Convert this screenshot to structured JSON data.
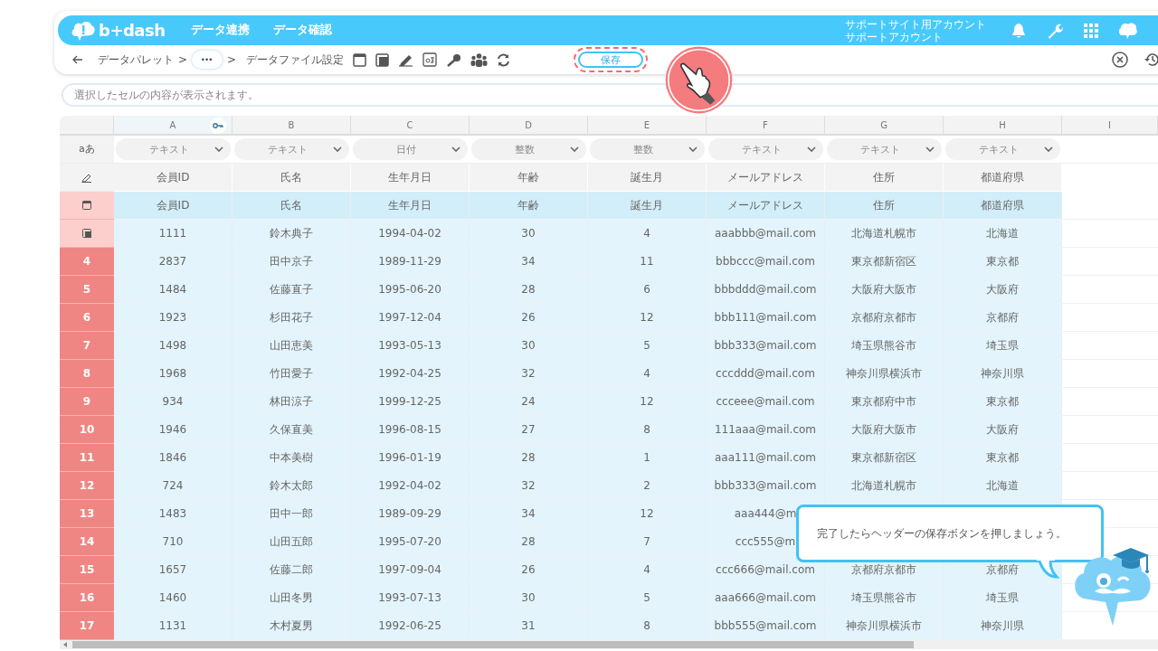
{
  "header": {
    "logo_text": "b+dash",
    "nav": [
      "データ連携",
      "データ確認"
    ],
    "account": [
      "サポートサイト用アカウント",
      "サポートアカウント"
    ]
  },
  "breadcrumb": [
    {
      "kind": "link",
      "text": "データパレット"
    },
    {
      "kind": "separator",
      "text": ">"
    },
    {
      "kind": "more",
      "text": "•••"
    },
    {
      "kind": "separator",
      "text": ">"
    },
    {
      "kind": "current",
      "text": "データファイル設定"
    }
  ],
  "save_button": {
    "label": "保存",
    "highlighted": true
  },
  "formula_bar": {
    "placeholder": "選択したセルの内容が表示されます。"
  },
  "type_row_label": "aあ",
  "columns": [
    {
      "letter": "A",
      "type": "テキスト",
      "key": true
    },
    {
      "letter": "B",
      "type": "テキスト",
      "key": false
    },
    {
      "letter": "C",
      "type": "日付",
      "key": false
    },
    {
      "letter": "D",
      "type": "整数",
      "key": false
    },
    {
      "letter": "E",
      "type": "整数",
      "key": false
    },
    {
      "letter": "F",
      "type": "テキスト",
      "key": false
    },
    {
      "letter": "G",
      "type": "テキスト",
      "key": false
    },
    {
      "letter": "H",
      "type": "テキスト",
      "key": false
    },
    {
      "letter": "I",
      "key": false
    }
  ],
  "rows": [
    {
      "kind": "label",
      "cells": [
        "会員ID",
        "氏名",
        "生年月日",
        "年齢",
        "誕生月",
        "メールアドレス",
        "住所",
        "都道府県"
      ]
    },
    {
      "kind": "header",
      "cells": [
        "会員ID",
        "氏名",
        "生年月日",
        "年齢",
        "誕生月",
        "メールアドレス",
        "住所",
        "都道府県"
      ]
    },
    {
      "kind": "first",
      "cells": [
        "1111",
        "鈴木典子",
        "1994-04-02",
        "30",
        "4",
        "aaabbb@mail.com",
        "北海道札幌市",
        "北海道"
      ]
    },
    {
      "kind": "data",
      "number": "4",
      "cells": [
        "2837",
        "田中京子",
        "1989-11-29",
        "34",
        "11",
        "bbbccc@mail.com",
        "東京都新宿区",
        "東京都"
      ]
    },
    {
      "kind": "data",
      "number": "5",
      "cells": [
        "1484",
        "佐藤直子",
        "1995-06-20",
        "28",
        "6",
        "bbbddd@mail.com",
        "大阪府大阪市",
        "大阪府"
      ]
    },
    {
      "kind": "data",
      "number": "6",
      "cells": [
        "1923",
        "杉田花子",
        "1997-12-04",
        "26",
        "12",
        "bbb111@mail.com",
        "京都府京都市",
        "京都府"
      ]
    },
    {
      "kind": "data",
      "number": "7",
      "cells": [
        "1498",
        "山田恵美",
        "1993-05-13",
        "30",
        "5",
        "bbb333@mail.com",
        "埼玉県熊谷市",
        "埼玉県"
      ]
    },
    {
      "kind": "data",
      "number": "8",
      "cells": [
        "1968",
        "竹田愛子",
        "1992-04-25",
        "32",
        "4",
        "cccddd@mail.com",
        "神奈川県横浜市",
        "神奈川県"
      ]
    },
    {
      "kind": "data",
      "number": "9",
      "cells": [
        "934",
        "林田涼子",
        "1999-12-25",
        "24",
        "12",
        "ccceee@mail.com",
        "東京都府中市",
        "東京都"
      ]
    },
    {
      "kind": "data",
      "number": "10",
      "cells": [
        "1946",
        "久保直美",
        "1996-08-15",
        "27",
        "8",
        "111aaa@mail.com",
        "大阪府大阪市",
        "大阪府"
      ]
    },
    {
      "kind": "data",
      "number": "11",
      "cells": [
        "1846",
        "中本美樹",
        "1996-01-19",
        "28",
        "1",
        "aaa111@mail.com",
        "東京都新宿区",
        "東京都"
      ]
    },
    {
      "kind": "data",
      "number": "12",
      "cells": [
        "724",
        "鈴木太郎",
        "1992-04-02",
        "32",
        "2",
        "bbb333@mail.com",
        "北海道札幌市",
        "北海道"
      ]
    },
    {
      "kind": "data",
      "number": "13",
      "cells": [
        "1483",
        "田中一郎",
        "1989-09-29",
        "34",
        "12",
        "aaa444@m",
        "",
        ""
      ]
    },
    {
      "kind": "data",
      "number": "14",
      "cells": [
        "710",
        "山田五郎",
        "1995-07-20",
        "28",
        "7",
        "ccc555@m",
        "",
        ""
      ]
    },
    {
      "kind": "data",
      "number": "15",
      "cells": [
        "1657",
        "佐藤二郎",
        "1997-09-04",
        "26",
        "4",
        "ccc666@mail.com",
        "京都府京都市",
        "京都府"
      ]
    },
    {
      "kind": "data",
      "number": "16",
      "cells": [
        "1460",
        "山田冬男",
        "1993-07-13",
        "30",
        "5",
        "aaa666@mail.com",
        "埼玉県熊谷市",
        "埼玉県"
      ]
    },
    {
      "kind": "data",
      "number": "17",
      "cells": [
        "1131",
        "木村夏男",
        "1992-06-25",
        "31",
        "8",
        "bbb555@mail.com",
        "神奈川県横浜市",
        "神奈川県"
      ]
    }
  ],
  "tooltip": {
    "text": "完了したらヘッダーの保存ボタンを押しましょう。"
  }
}
